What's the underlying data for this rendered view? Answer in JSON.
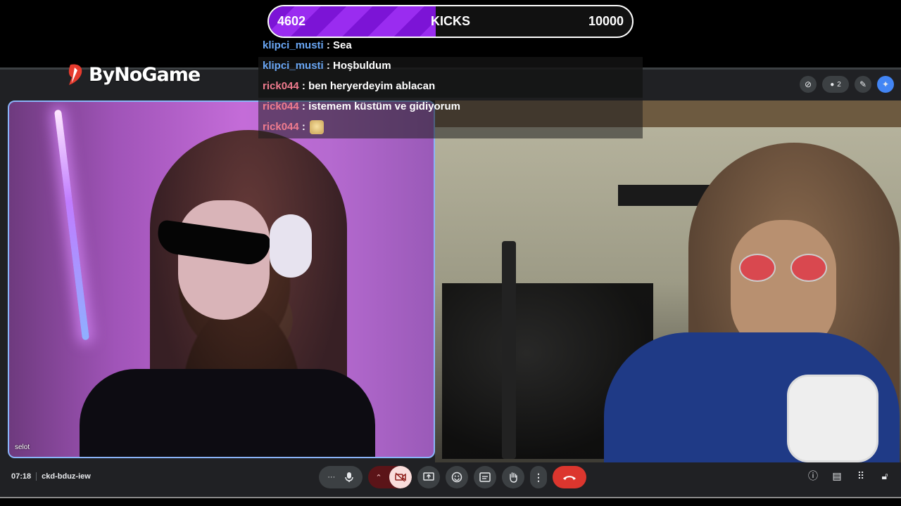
{
  "goal": {
    "current": "4602",
    "label": "KICKS",
    "target": "10000",
    "progress_fraction": 0.4602,
    "fill_color": "#8a1ee6"
  },
  "brand": {
    "name": "ByNoGame",
    "accent": "#e63b2e"
  },
  "chat": [
    {
      "user": "klipci_musti",
      "sep": " : ",
      "message": "Sea",
      "user_color": "#6aa7f5"
    },
    {
      "user": "klipci_musti",
      "sep": " : ",
      "message": "Hoşbuldum",
      "user_color": "#6aa7f5"
    },
    {
      "user": "rick044",
      "sep": " : ",
      "message": "ben heryerdeyim ablacan",
      "user_color": "#f07c8e"
    },
    {
      "user": "rick044",
      "sep": " : ",
      "message": "istemem küstüm ve gidiyorum",
      "user_color": "#f07c8e"
    },
    {
      "user": "rick044",
      "sep": " : ",
      "message": "",
      "emote": "emote-icon",
      "user_color": "#f07c8e"
    }
  ],
  "participants": [
    {
      "name": "selot",
      "highlight_color": "#8ab4f8"
    }
  ],
  "top_icons": {
    "participant_count": "2"
  },
  "meeting": {
    "time": "07:18",
    "code": "ckd-bduz-iew"
  },
  "controls": {
    "more_label": "···",
    "mic_icon": "mic-icon",
    "camera_icon": "camera-off-icon",
    "present_icon": "present-icon",
    "emoji_icon": "emoji-icon",
    "captions_icon": "captions-icon",
    "hand_icon": "raise-hand-icon",
    "options_icon": "more-vert-icon",
    "end_icon": "end-call-icon",
    "end_color": "#dc362e"
  },
  "right_controls": [
    "info-icon",
    "chat-icon",
    "activities-icon",
    "host-controls-icon"
  ]
}
